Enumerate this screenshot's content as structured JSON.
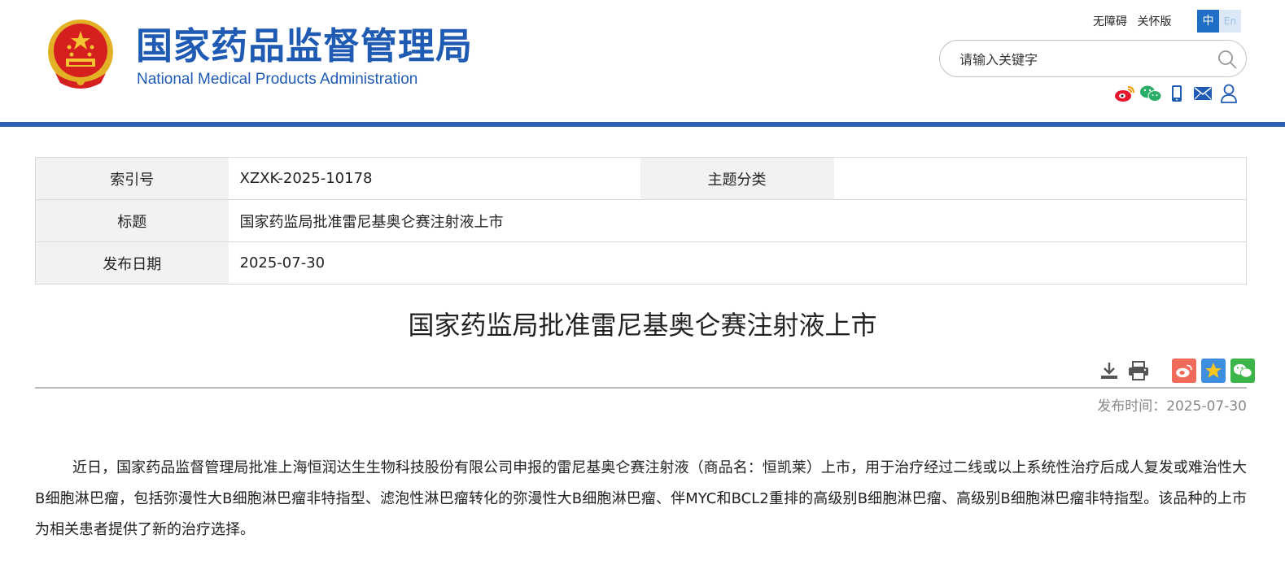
{
  "header": {
    "brand_cn": "国家药品监督管理局",
    "brand_en": "National Medical Products Administration",
    "links": {
      "accessibility": "无障碍",
      "elder": "关怀版"
    },
    "lang": {
      "zh": "中",
      "en": "En"
    },
    "search": {
      "placeholder": "请输入关键字"
    },
    "social_icons": [
      "weibo-icon",
      "wechat-icon",
      "mobile-icon",
      "mail-icon",
      "user-icon"
    ],
    "accent_color": "#2c5fb3"
  },
  "info": {
    "index_label": "索引号",
    "index_value": "XZXK-2025-10178",
    "topic_label": "主题分类",
    "topic_value": "",
    "title_label": "标题",
    "title_value": "国家药监局批准雷尼基奥仑赛注射液上市",
    "date_label": "发布日期",
    "date_value": "2025-07-30"
  },
  "article": {
    "title": "国家药监局批准雷尼基奥仑赛注射液上市",
    "tool_icons": [
      "download-icon",
      "print-icon",
      "share-weibo-icon",
      "share-qzone-icon",
      "share-wechat-icon"
    ],
    "pubtime": "发布时间：2025-07-30",
    "paragraph": "近日，国家药品监督管理局批准上海恒润达生生物科技股份有限公司申报的雷尼基奥仑赛注射液（商品名：恒凯莱）上市，用于治疗经过二线或以上系统性治疗后成人复发或难治性大B细胞淋巴瘤，包括弥漫性大B细胞淋巴瘤非特指型、滤泡性淋巴瘤转化的弥漫性大B细胞淋巴瘤、伴MYC和BCL2重排的高级别B细胞淋巴瘤、高级别B细胞淋巴瘤非特指型。该品种的上市为相关患者提供了新的治疗选择。"
  }
}
